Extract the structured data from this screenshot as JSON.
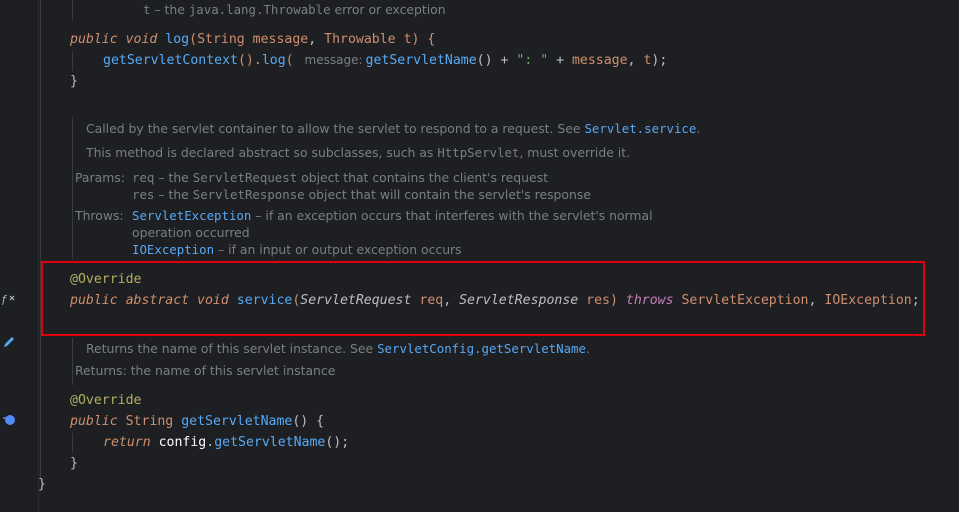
{
  "top_doc_partial": {
    "param": "t",
    "dash": " – the ",
    "type": "java.lang.Throwable",
    "rest": " error or exception"
  },
  "log_method": {
    "modifiers": "public void",
    "name": "log",
    "open": "(",
    "p1_type": "String",
    "p1_name": "message",
    "comma": ", ",
    "p2_type": "Throwable",
    "p2_name": "t",
    "close": ") {",
    "body_call1": "getServletContext",
    "body_paren": "().",
    "body_call2": "log",
    "body_open": "( ",
    "hint": "message:",
    "body_call3": "getServletName",
    "body_op1": "() + ",
    "string": "\": \"",
    "body_op2": " + ",
    "arg_message": "message",
    "arg_comma": ", ",
    "arg_t": "t",
    "end": ");",
    "brace": "}"
  },
  "service_doc": {
    "line1_text": "Called by the servlet container to allow the servlet to respond to a request. See ",
    "line1_link": "Servlet.service",
    "line1_end": ".",
    "line2_a": "This method is declared abstract so subclasses, such as ",
    "line2_code": "HttpServlet",
    "line2_b": ", must override it.",
    "params_label": "Params:",
    "param1_name": "req",
    "param1_a": " – the ",
    "param1_code": "ServletRequest",
    "param1_b": " object that contains the client's request",
    "param2_name": "res",
    "param2_a": " – the ",
    "param2_code": "ServletResponse",
    "param2_b": " object that will contain the servlet's response",
    "throws_label": "Throws:",
    "throw1_link": "ServletException",
    "throw1_text": " – if an exception occurs that interferes with the servlet's normal",
    "throw1_cont": "operation occurred",
    "throw2_link": "IOException",
    "throw2_text": " – if an input or output exception occurs"
  },
  "service_method": {
    "annotation": "@Override",
    "modifiers": "public abstract void",
    "name": "service",
    "open": "(",
    "p1_type": "ServletRequest",
    "p1_name": "req",
    "comma": ", ",
    "p2_type": "ServletResponse",
    "p2_name": "res",
    "close": ") ",
    "throws_kw": "throws",
    "ex1": "ServletException",
    "ex_comma": ", ",
    "ex2": "IOException",
    "semi": ";"
  },
  "name_doc": {
    "line1_text": "Returns the name of this servlet instance. See ",
    "line1_link": "ServletConfig.getServletName",
    "line1_end": ".",
    "returns_label": "Returns:",
    "returns_text": "the name of this servlet instance"
  },
  "getname_method": {
    "annotation": "@Override",
    "modifiers": "public",
    "ret_type": "String",
    "name": "getServletName",
    "sig_end": "() {",
    "return_kw": "return",
    "obj": "config",
    "dot": ".",
    "call": "getServletName",
    "end": "();",
    "brace": "}"
  },
  "class_brace": "}",
  "gutter_icons": [
    "function-override-icon",
    "edit-icon",
    "implemented-icon"
  ],
  "colors": {
    "background": "#1e1f22",
    "keyword": "#cf8e6d",
    "function": "#56a8f5",
    "annotation": "#b3ae60",
    "string": "#6aab73",
    "doc_text": "#7a7e85",
    "highlight_border": "#e0000f"
  }
}
